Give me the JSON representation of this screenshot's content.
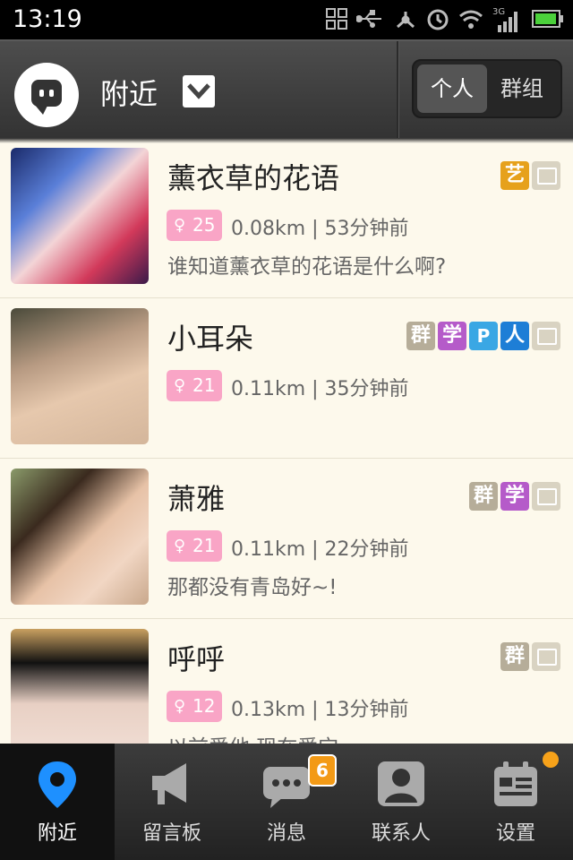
{
  "status": {
    "time": "13:19",
    "network": "3G"
  },
  "header": {
    "title": "附近",
    "segments": [
      "个人",
      "群组"
    ],
    "active_segment": "个人"
  },
  "users": [
    {
      "name": "薰衣草的花语",
      "age": "25",
      "gender_symbol": "♀",
      "meta": "0.08km | 53分钟前",
      "signature": "谁知道薰衣草的花语是什么啊?",
      "tags": [
        "艺",
        "photo"
      ]
    },
    {
      "name": "小耳朵",
      "age": "21",
      "gender_symbol": "♀",
      "meta": "0.11km | 35分钟前",
      "signature": "",
      "tags": [
        "群",
        "学",
        "P",
        "人",
        "photo"
      ]
    },
    {
      "name": "萧雅",
      "age": "21",
      "gender_symbol": "♀",
      "meta": "0.11km | 22分钟前",
      "signature": "那都没有青岛好~!",
      "tags": [
        "群",
        "学",
        "photo"
      ]
    },
    {
      "name": "呼呼",
      "age": "12",
      "gender_symbol": "♀",
      "meta": "0.13km | 13分钟前",
      "signature": "以前爱他,现在爱它",
      "tags": [
        "群",
        "photo"
      ]
    }
  ],
  "tabbar": {
    "tabs": [
      "附近",
      "留言板",
      "消息",
      "联系人",
      "设置"
    ],
    "active": "附近",
    "messages_badge": "6"
  },
  "colors": {
    "accent": "#f39a16",
    "age_badge": "#f9a5c6",
    "header": "#3d3d3d",
    "list_bg": "#fdf9ec"
  }
}
